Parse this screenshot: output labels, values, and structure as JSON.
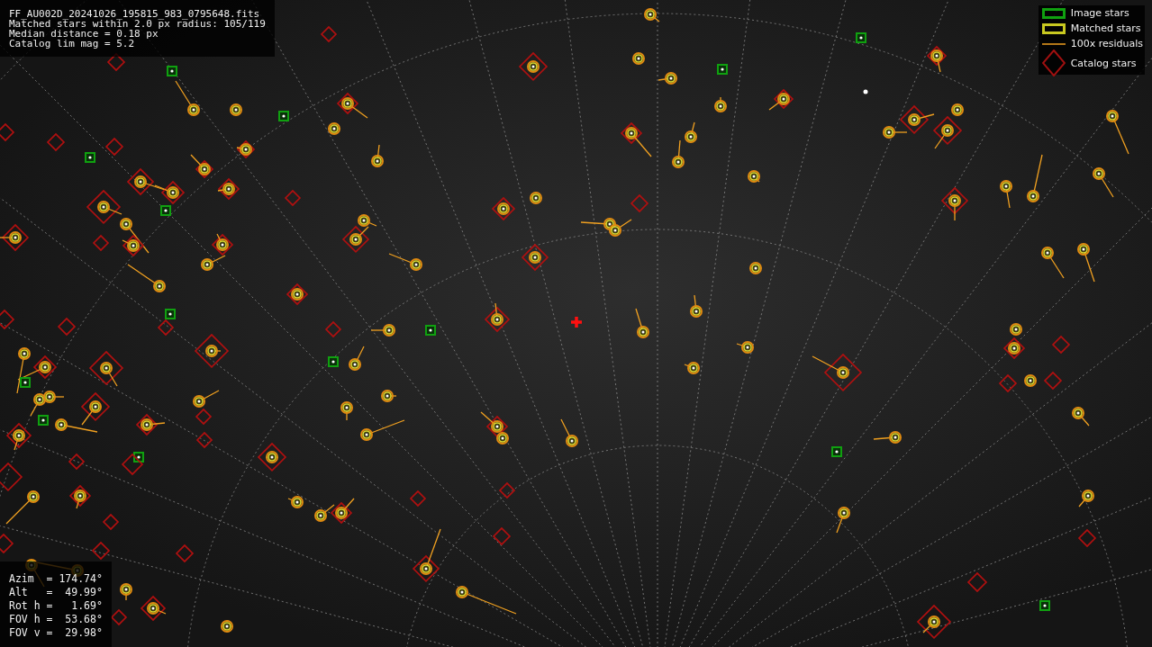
{
  "file_info": [
    "FF_AU002D_20241026_195815_983_0795648.fits",
    "Matched stars within 2.0 px radius: 105/119",
    "Median distance = 0.18 px",
    "Catalog lim mag = 5.2"
  ],
  "legend": [
    {
      "kind": "image",
      "label": "Image stars"
    },
    {
      "kind": "matched",
      "label": "Matched stars"
    },
    {
      "kind": "residual",
      "label": "100x residuals"
    },
    {
      "kind": "catalog",
      "label": "Catalog stars"
    }
  ],
  "pointing": [
    "Azim  = 174.74°",
    "Alt   =  49.99°",
    "Rot h =   1.69°",
    "FOV h =  53.68°",
    "FOV v =  29.98°"
  ]
}
